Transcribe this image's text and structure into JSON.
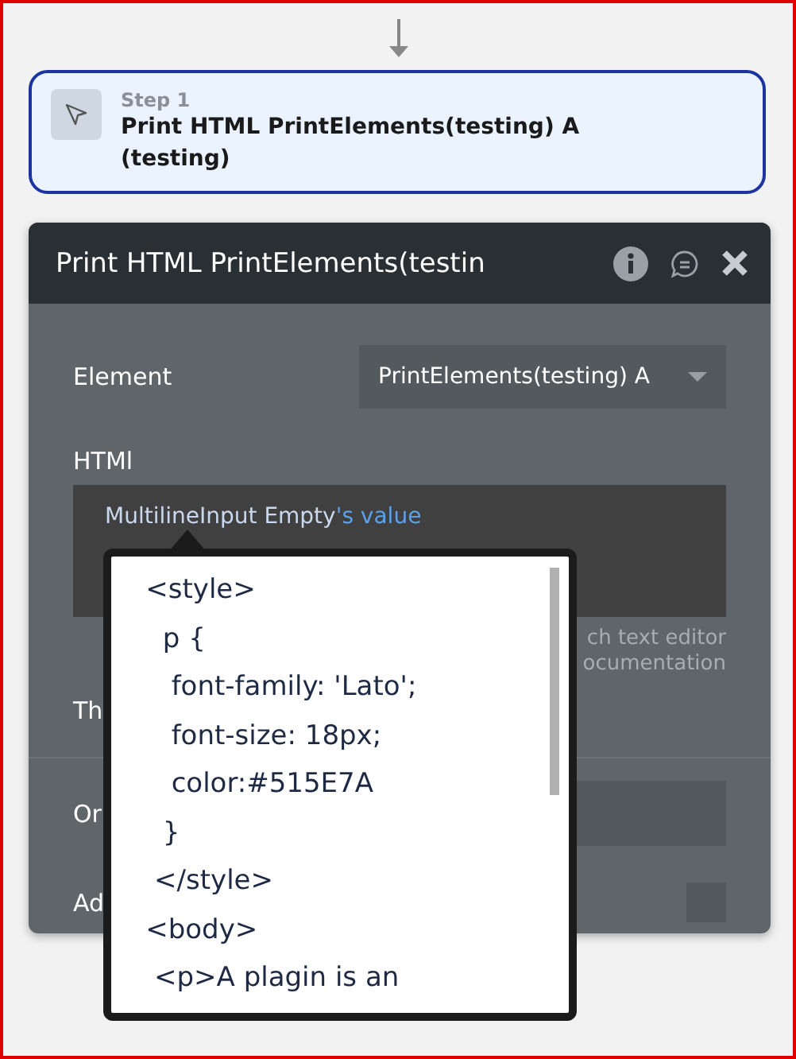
{
  "step": {
    "label": "Step 1",
    "title": "Print HTML PrintElements(testing) A (testing)"
  },
  "panel": {
    "title": "Print HTML PrintElements(testin",
    "fields": [
      {
        "kind": "dropdown",
        "label": "Element",
        "value": "PrintElements(testing) A"
      },
      {
        "kind": "expression",
        "label": "HTMl",
        "value": "MultilineInput Empty",
        "suffix": "'s value",
        "hint": [
          "ch text editor",
          "ocumentation"
        ]
      },
      {
        "kind": "label",
        "label": "Th"
      },
      {
        "kind": "input",
        "label": "Or"
      },
      {
        "kind": "checkbox",
        "label": "Ad",
        "checked": false
      }
    ]
  },
  "tooltip": {
    "lines": [
      "    <style>",
      "      p {",
      "       font-family: 'Lato';",
      "       font-size: 18px;",
      "       color:#515E7A",
      "      }",
      "     </style>",
      "    <body>",
      "     <p>A plagin is an"
    ]
  }
}
